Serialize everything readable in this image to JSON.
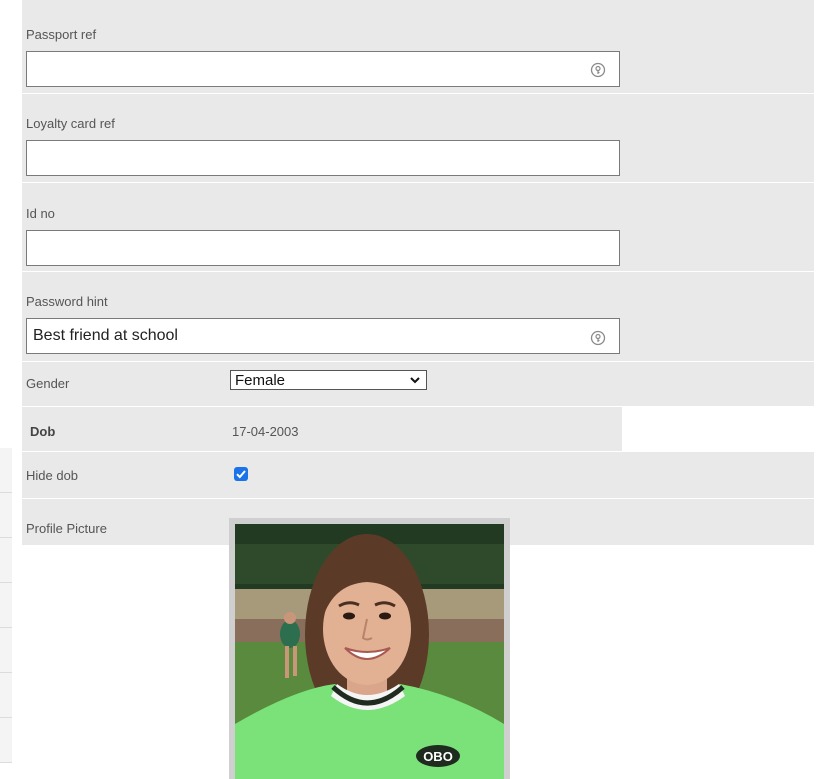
{
  "form": {
    "passport": {
      "label": "Passport ref",
      "value": ""
    },
    "loyalty": {
      "label": "Loyalty card ref",
      "value": ""
    },
    "idno": {
      "label": "Id no",
      "value": ""
    },
    "password_hint": {
      "label": "Password hint",
      "value": "Best friend at school"
    },
    "gender": {
      "label": "Gender",
      "selected": "Female"
    },
    "dob": {
      "label": "Dob",
      "value": "17-04-2003"
    },
    "hide_dob": {
      "label": "Hide dob",
      "checked": true
    },
    "profile_picture": {
      "label": "Profile Picture"
    }
  },
  "photo": {
    "jersey_logo": "OBO"
  },
  "icons": {
    "field_icon": "password-manager-key-icon",
    "select_chevron": "chevron-down-icon",
    "checkbox_check": "check-icon"
  },
  "colors": {
    "band": "#e9e9e9",
    "input_border": "#7a7a7a",
    "checkbox": "#1a73e8",
    "photo_frame": "#cfcfcf"
  }
}
